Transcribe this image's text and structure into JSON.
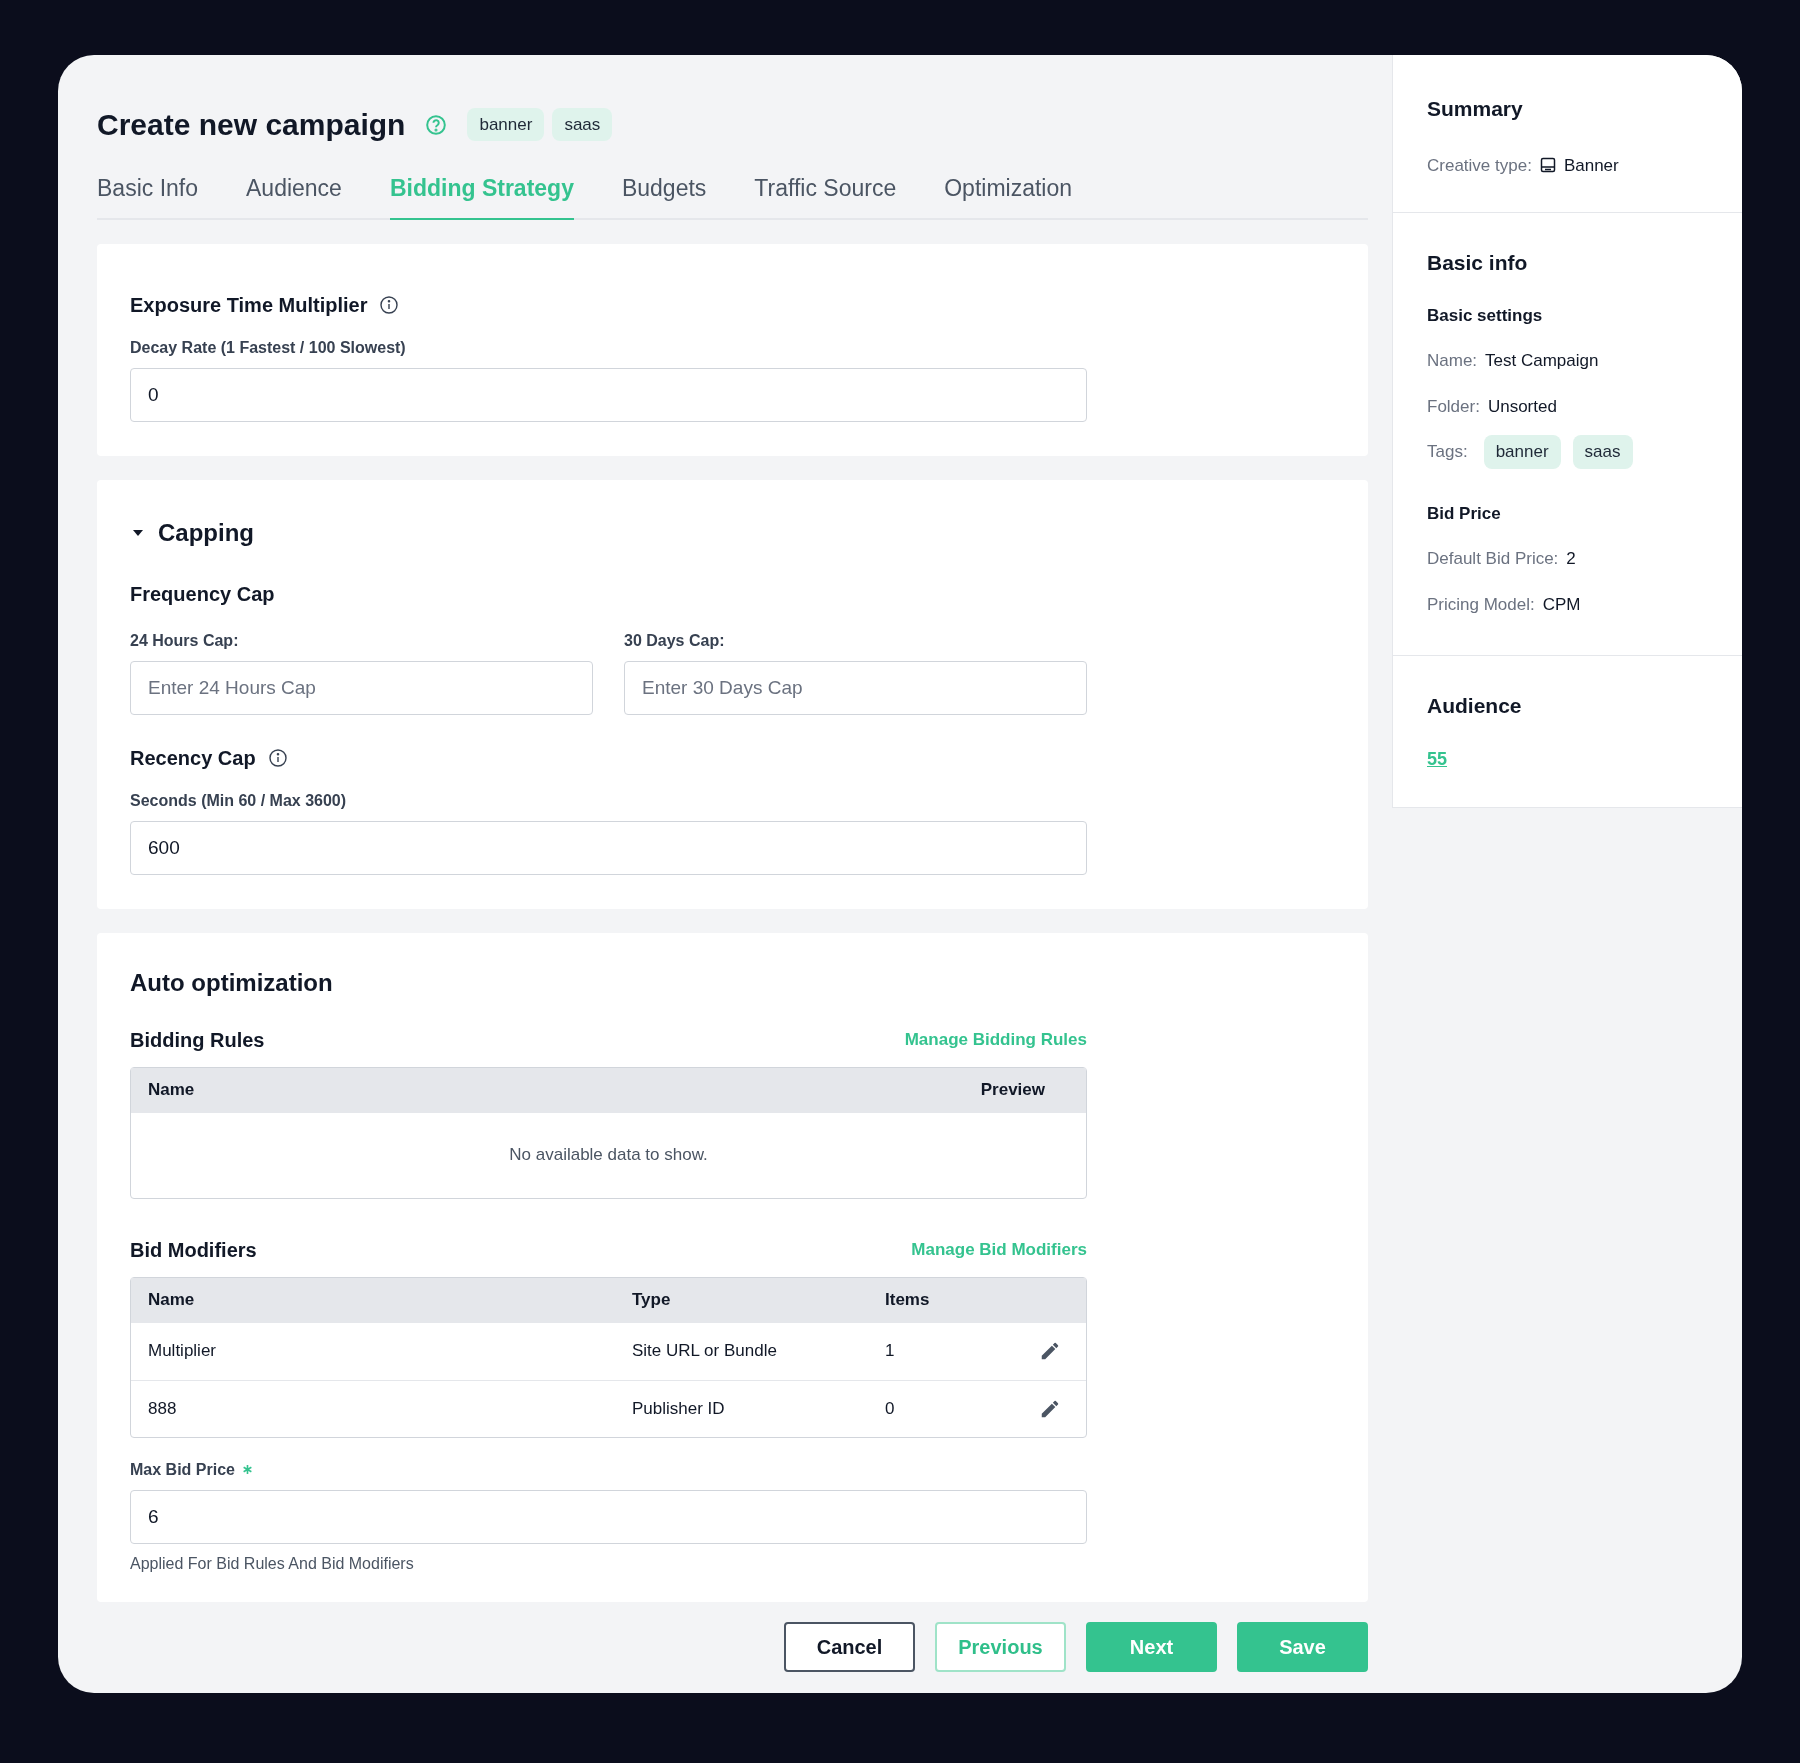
{
  "header": {
    "title": "Create new campaign",
    "tags": [
      "banner",
      "saas"
    ]
  },
  "tabs": [
    {
      "label": "Basic Info",
      "selected": false
    },
    {
      "label": "Audience",
      "selected": false
    },
    {
      "label": "Bidding Strategy",
      "selected": true
    },
    {
      "label": "Budgets",
      "selected": false
    },
    {
      "label": "Traffic Source",
      "selected": false
    },
    {
      "label": "Optimization",
      "selected": false
    }
  ],
  "exposure": {
    "title": "Exposure Time Multiplier",
    "label": "Decay Rate (1 Fastest / 100 Slowest)",
    "value": "0"
  },
  "capping": {
    "title": "Capping",
    "expanded": true,
    "frequency_title": "Frequency Cap",
    "fields": [
      {
        "label": "24 Hours Cap:",
        "placeholder": "Enter 24 Hours Cap"
      },
      {
        "label": "30 Days Cap:",
        "placeholder": "Enter 30 Days Cap"
      }
    ],
    "recency_title": "Recency Cap",
    "recency_label": "Seconds (Min 60 / Max 3600)",
    "recency_value": "600"
  },
  "auto_optimization": {
    "title": "Auto optimization",
    "bidding_rules": {
      "title": "Bidding Rules",
      "link": "Manage Bidding Rules",
      "columns": [
        "Name",
        "Preview"
      ],
      "empty": "No available data to show."
    },
    "bid_modifiers": {
      "title": "Bid Modifiers",
      "link": "Manage Bid Modifiers",
      "columns": [
        "Name",
        "Type",
        "Items"
      ],
      "rows": [
        [
          "Multiplier",
          "Site URL or Bundle",
          "1"
        ],
        [
          "888",
          "Publisher ID",
          "0"
        ]
      ]
    },
    "max_bid": {
      "label": "Max Bid Price",
      "required": true,
      "value": "6",
      "hint": "Applied For Bid Rules And Bid Modifiers"
    }
  },
  "buttons": [
    {
      "label": "Cancel",
      "kind": "outline"
    },
    {
      "label": "Previous",
      "kind": "secondary"
    },
    {
      "label": "Next",
      "kind": "primary"
    },
    {
      "label": "Save",
      "kind": "primary"
    }
  ],
  "summary": {
    "title": "Summary",
    "creative_label": "Creative type:",
    "creative_value": "Banner",
    "basic_title": "Basic info",
    "basic_settings": "Basic settings",
    "items": [
      {
        "label": "Name:",
        "value": "Test Campaign"
      },
      {
        "label": "Folder:",
        "value": "Unsorted"
      }
    ],
    "tags_label": "Tags:",
    "tags": [
      "banner",
      "saas"
    ],
    "bid_title": "Bid Price",
    "bid_items": [
      {
        "label": "Default Bid Price:",
        "value": "2"
      },
      {
        "label": "Pricing Model:",
        "value": "CPM"
      }
    ],
    "audience_title": "Audience",
    "audience_link": "55"
  }
}
